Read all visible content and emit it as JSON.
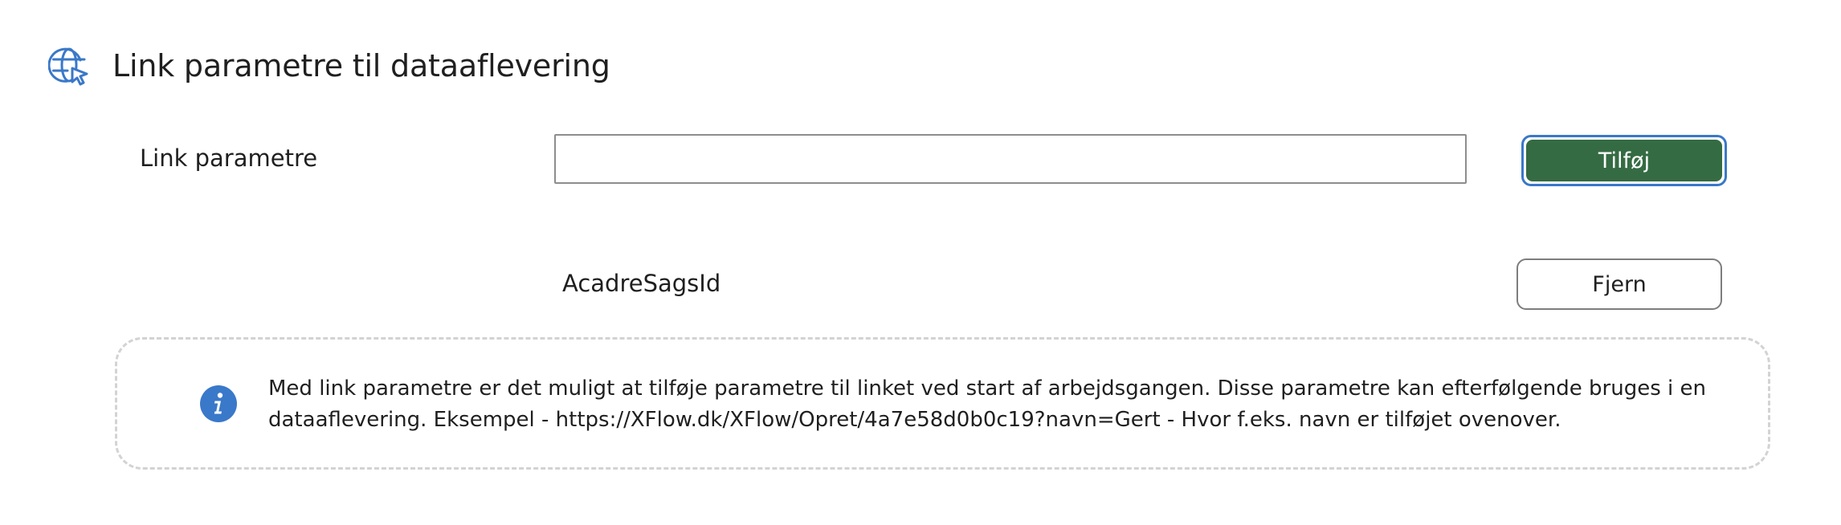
{
  "header": {
    "icon": "globe-cursor-icon",
    "title": "Link parametre til dataaflevering"
  },
  "form": {
    "field_label": "Link parametre",
    "input_value": "",
    "input_placeholder": "",
    "add_button_label": "Tilføj"
  },
  "parameters": [
    {
      "name": "AcadreSagsId",
      "remove_label": "Fjern"
    }
  ],
  "info": {
    "icon": "info-icon",
    "text": "Med link parametre er det muligt at tilføje parametre til linket ved start af arbejdsgangen. Disse parametre kan efterfølgende bruges i en dataaflevering. Eksempel - https://XFlow.dk/XFlow/Opret/4a7e58d0b0c19?navn=Gert - Hvor f.eks. navn er tilføjet ovenover."
  },
  "colors": {
    "accent_blue": "#3a78c9",
    "primary_green": "#356b43",
    "info_blue": "#3a78c9",
    "dashed_border": "#d3d3d3"
  }
}
